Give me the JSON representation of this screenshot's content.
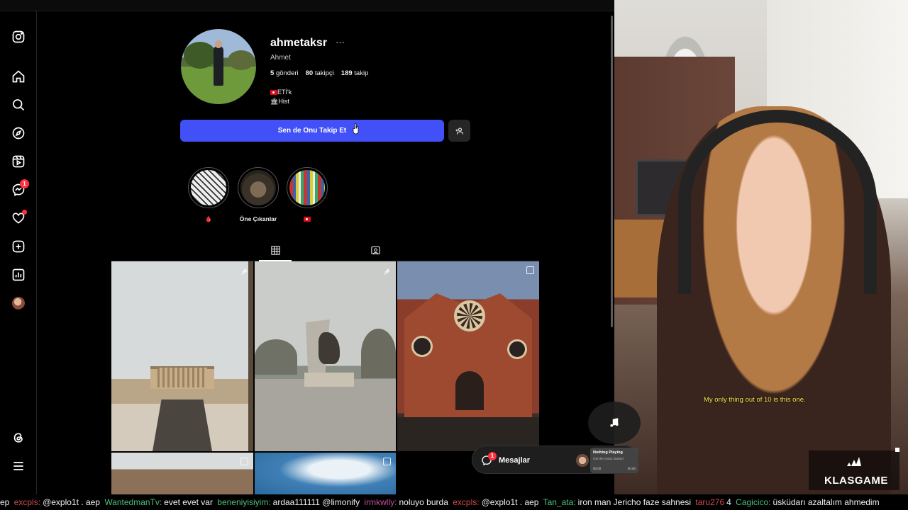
{
  "profile": {
    "username": "ahmetaksr",
    "more_label": "···",
    "full_name": "Ahmet",
    "stats": [
      {
        "count": "5",
        "label": "gönderi"
      },
      {
        "count": "80",
        "label": "takipçi"
      },
      {
        "count": "189",
        "label": "takip"
      }
    ],
    "bio_line1": "ETİ'k",
    "bio_line2": "Hist",
    "follow_button": "Sen de Onu Takip Et"
  },
  "highlights": [
    {
      "label": "🩸",
      "icon": "drop-emoji"
    },
    {
      "label": "Öne Çıkanlar",
      "icon": "cat-photo"
    },
    {
      "label": "",
      "icon": "turkish-flag"
    }
  ],
  "nav": {
    "items": [
      "instagram-logo",
      "home",
      "search",
      "explore",
      "reels",
      "messages",
      "notifications",
      "create",
      "dashboard",
      "profile",
      "threads",
      "more"
    ],
    "messages_badge": "1"
  },
  "messages_bar": {
    "label": "Mesajlar",
    "badge": "1"
  },
  "now_playing": {
    "title": "Nothing Playing",
    "subtitle": "Get the music started",
    "time_start": "00:00",
    "time_end": "00:00"
  },
  "stream": {
    "caption": "My only thing out of 10 is this one.",
    "brand_name": "KLASGAME"
  },
  "chat_ticker": [
    {
      "user": "ep",
      "msg": ""
    },
    {
      "user": "excpls:",
      "msg": "@explo1t . aep"
    },
    {
      "user": "WantedmanTv:",
      "msg": "evet evet var"
    },
    {
      "user": "beneniyisiyim:",
      "msg": "ardaa111111 @limonify"
    },
    {
      "user": "irmkwlly:",
      "msg": "noluyo burda"
    },
    {
      "user": "excpls:",
      "msg": "@explo1t . aep"
    },
    {
      "user": "Tan_ata:",
      "msg": "iron man Jericho faze sahnesi"
    },
    {
      "user": "taru276",
      "msg": "4"
    },
    {
      "user": "Cagicico:",
      "msg": "üsküdarı azaltalım ahmedim"
    }
  ],
  "colors": {
    "follow_button": "#4150f7",
    "badge": "#ff3040",
    "caption": "#f7e54a"
  }
}
